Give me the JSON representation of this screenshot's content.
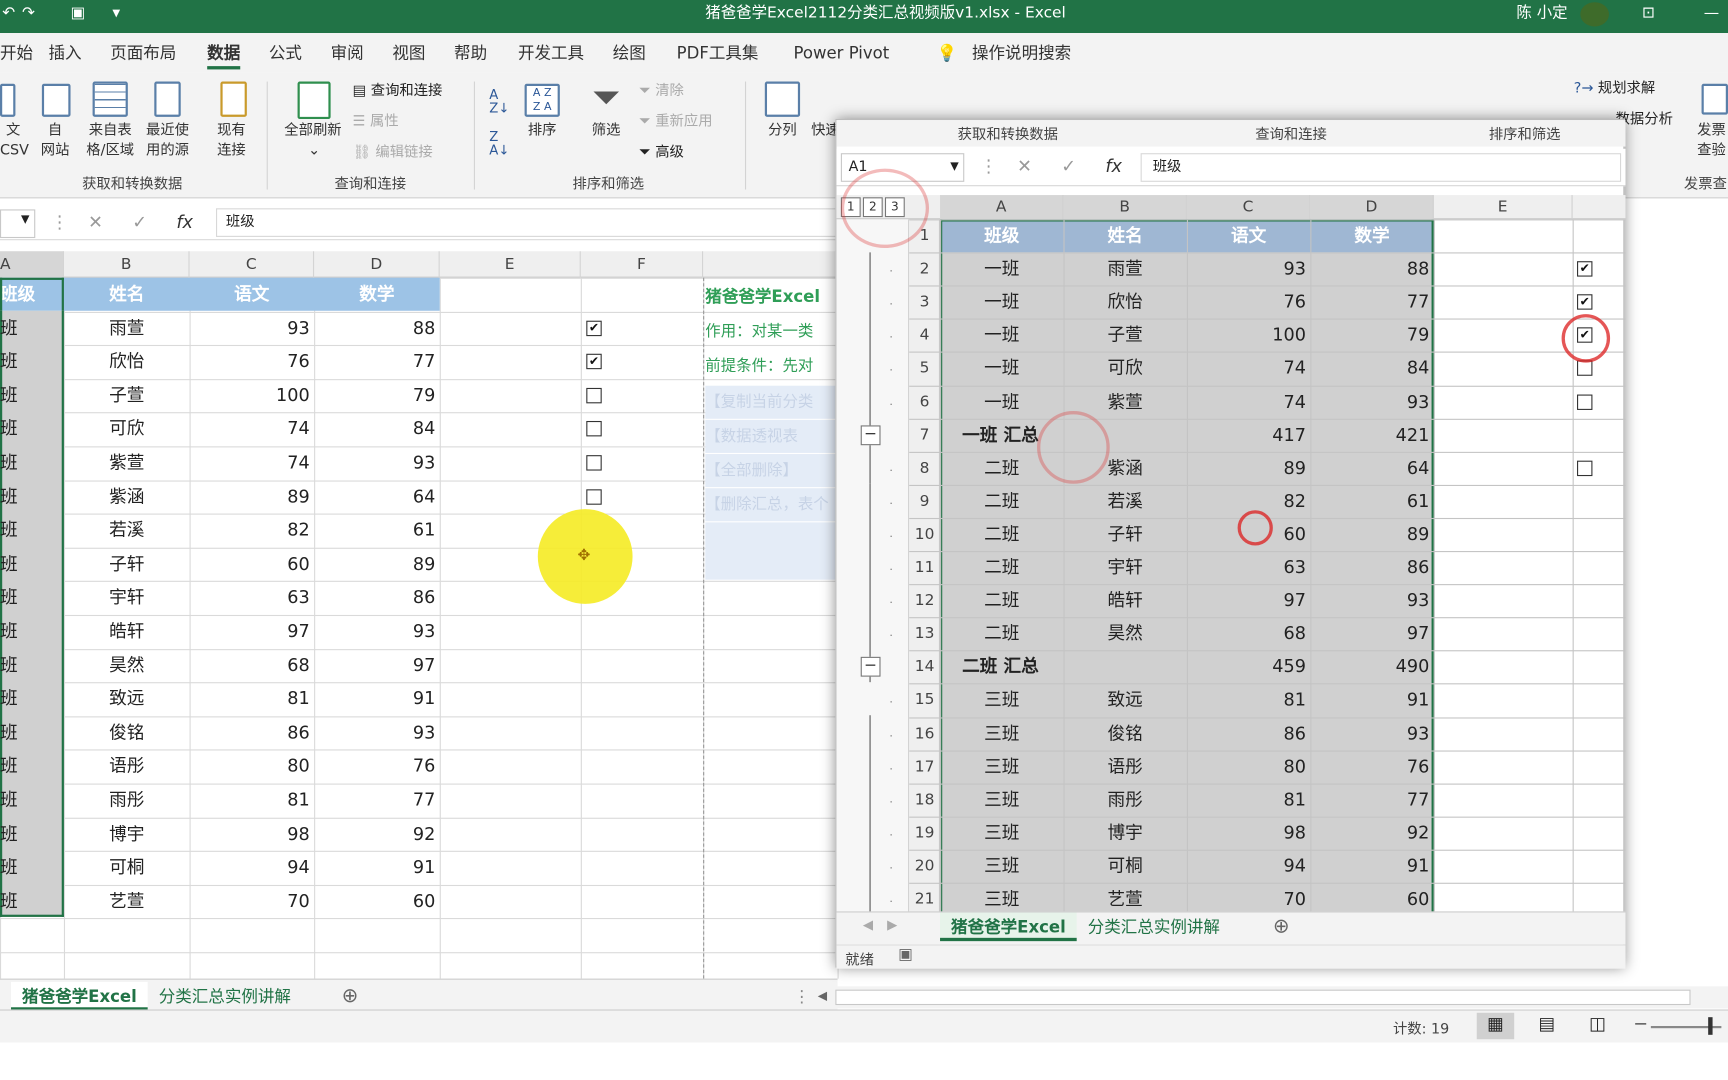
{
  "titlebar": {
    "file_title": "猪爸爸学Excel2112分类汇总视频版v1.xlsx  -  Excel",
    "user": "陈 小定"
  },
  "menu": [
    "开始",
    "插入",
    "页面布局",
    "数据",
    "公式",
    "审阅",
    "视图",
    "帮助",
    "开发工具",
    "绘图",
    "PDF工具集",
    "Power Pivot",
    "操作说明搜索"
  ],
  "ribbon": {
    "get_data_items": [
      "文\nCSV",
      "自\n网站",
      "来自表\n格/区域",
      "最近使\n用的源",
      "现有\n连接"
    ],
    "refresh_all": "全部刷新",
    "query_connections": "查询和连接",
    "properties": "属性",
    "edit_links": "编辑链接",
    "sort": "排序",
    "filter": "筛选",
    "clear": "清除",
    "reapply": "重新应用",
    "advanced": "高级",
    "text_to_columns": "分列",
    "quick": "快速",
    "solver": "规划求解",
    "analysis": "数据分析",
    "invoice": "发票\n查验",
    "groups": [
      "获取和转换数据",
      "查询和连接",
      "排序和筛选"
    ],
    "groups_popup": [
      "获取和转换数据",
      "查询和连接",
      "排序和筛选"
    ],
    "invoice_group": "发票查"
  },
  "formula": {
    "fx": "fx",
    "content": "班级",
    "popup_namebox": "A1"
  },
  "columns": [
    "A",
    "B",
    "C",
    "D",
    "E",
    "F"
  ],
  "headers": [
    "班级",
    "姓名",
    "语文",
    "数学"
  ],
  "main_rows": [
    {
      "cls": "班",
      "name": "雨萱",
      "chinese": "93",
      "math": "88",
      "cb": "checked"
    },
    {
      "cls": "班",
      "name": "欣怡",
      "chinese": "76",
      "math": "77",
      "cb": "checked"
    },
    {
      "cls": "班",
      "name": "子萱",
      "chinese": "100",
      "math": "79",
      "cb": "unchecked"
    },
    {
      "cls": "班",
      "name": "可欣",
      "chinese": "74",
      "math": "84",
      "cb": "unchecked"
    },
    {
      "cls": "班",
      "name": "紫萱",
      "chinese": "74",
      "math": "93",
      "cb": "unchecked"
    },
    {
      "cls": "班",
      "name": "紫涵",
      "chinese": "89",
      "math": "64",
      "cb": "unchecked"
    },
    {
      "cls": "班",
      "name": "若溪",
      "chinese": "82",
      "math": "61",
      "cb": ""
    },
    {
      "cls": "班",
      "name": "子轩",
      "chinese": "60",
      "math": "89",
      "cb": ""
    },
    {
      "cls": "班",
      "name": "宇轩",
      "chinese": "63",
      "math": "86",
      "cb": ""
    },
    {
      "cls": "班",
      "name": "皓轩",
      "chinese": "97",
      "math": "93",
      "cb": ""
    },
    {
      "cls": "班",
      "name": "昊然",
      "chinese": "68",
      "math": "97",
      "cb": ""
    },
    {
      "cls": "班",
      "name": "致远",
      "chinese": "81",
      "math": "91",
      "cb": ""
    },
    {
      "cls": "班",
      "name": "俊铭",
      "chinese": "86",
      "math": "93",
      "cb": ""
    },
    {
      "cls": "班",
      "name": "语彤",
      "chinese": "80",
      "math": "76",
      "cb": ""
    },
    {
      "cls": "班",
      "name": "雨彤",
      "chinese": "81",
      "math": "77",
      "cb": ""
    },
    {
      "cls": "班",
      "name": "博宇",
      "chinese": "98",
      "math": "92",
      "cb": ""
    },
    {
      "cls": "班",
      "name": "可桐",
      "chinese": "94",
      "math": "91",
      "cb": ""
    },
    {
      "cls": "班",
      "name": "艺萱",
      "chinese": "70",
      "math": "60",
      "cb": ""
    }
  ],
  "notes": {
    "title": "猪爸爸学Excel",
    "purpose": "作用：对某一类",
    "precondition": "前提条件：先对",
    "faded": [
      "【复制当前分类",
      "【数据透视表",
      "【全部删除】",
      "【删除汇总，表个"
    ]
  },
  "popup_rows": [
    {
      "row": "1",
      "cls": "班级",
      "name": "姓名",
      "chinese": "语文",
      "math": "数学",
      "header": true,
      "cb": ""
    },
    {
      "row": "2",
      "cls": "一班",
      "name": "雨萱",
      "chinese": "93",
      "math": "88",
      "cb": "checked"
    },
    {
      "row": "3",
      "cls": "一班",
      "name": "欣怡",
      "chinese": "76",
      "math": "77",
      "cb": "checked"
    },
    {
      "row": "4",
      "cls": "一班",
      "name": "子萱",
      "chinese": "100",
      "math": "79",
      "cb": "checked"
    },
    {
      "row": "5",
      "cls": "一班",
      "name": "可欣",
      "chinese": "74",
      "math": "84",
      "cb": "unchecked"
    },
    {
      "row": "6",
      "cls": "一班",
      "name": "紫萱",
      "chinese": "74",
      "math": "93",
      "cb": "unchecked"
    },
    {
      "row": "7",
      "cls": "一班 汇总",
      "name": "",
      "chinese": "417",
      "math": "421",
      "total": true,
      "cb": ""
    },
    {
      "row": "8",
      "cls": "二班",
      "name": "紫涵",
      "chinese": "89",
      "math": "64",
      "cb": "unchecked"
    },
    {
      "row": "9",
      "cls": "二班",
      "name": "若溪",
      "chinese": "82",
      "math": "61",
      "cb": ""
    },
    {
      "row": "10",
      "cls": "二班",
      "name": "子轩",
      "chinese": "60",
      "math": "89",
      "cb": ""
    },
    {
      "row": "11",
      "cls": "二班",
      "name": "宇轩",
      "chinese": "63",
      "math": "86",
      "cb": ""
    },
    {
      "row": "12",
      "cls": "二班",
      "name": "皓轩",
      "chinese": "97",
      "math": "93",
      "cb": ""
    },
    {
      "row": "13",
      "cls": "二班",
      "name": "昊然",
      "chinese": "68",
      "math": "97",
      "cb": ""
    },
    {
      "row": "14",
      "cls": "二班 汇总",
      "name": "",
      "chinese": "459",
      "math": "490",
      "total": true,
      "cb": ""
    },
    {
      "row": "15",
      "cls": "三班",
      "name": "致远",
      "chinese": "81",
      "math": "91",
      "cb": ""
    },
    {
      "row": "16",
      "cls": "三班",
      "name": "俊铭",
      "chinese": "86",
      "math": "93",
      "cb": ""
    },
    {
      "row": "17",
      "cls": "三班",
      "name": "语彤",
      "chinese": "80",
      "math": "76",
      "cb": ""
    },
    {
      "row": "18",
      "cls": "三班",
      "name": "雨彤",
      "chinese": "81",
      "math": "77",
      "cb": ""
    },
    {
      "row": "19",
      "cls": "三班",
      "name": "博宇",
      "chinese": "98",
      "math": "92",
      "cb": ""
    },
    {
      "row": "20",
      "cls": "三班",
      "name": "可桐",
      "chinese": "94",
      "math": "91",
      "cb": ""
    },
    {
      "row": "21",
      "cls": "三班",
      "name": "艺萱",
      "chinese": "70",
      "math": "60",
      "cb": ""
    }
  ],
  "outline_levels": [
    "1",
    "2",
    "3"
  ],
  "collapse_symbol": "−",
  "sheet_tabs": [
    "猪爸爸学Excel",
    "分类汇总实例讲解"
  ],
  "status": {
    "ready": "就绪",
    "count": "计数: 19"
  },
  "colors": {
    "excel_green": "#217346",
    "header_blue": "#9dc3e6",
    "selection_gray": "#d0d0d0",
    "note_green": "#2f9e57"
  }
}
